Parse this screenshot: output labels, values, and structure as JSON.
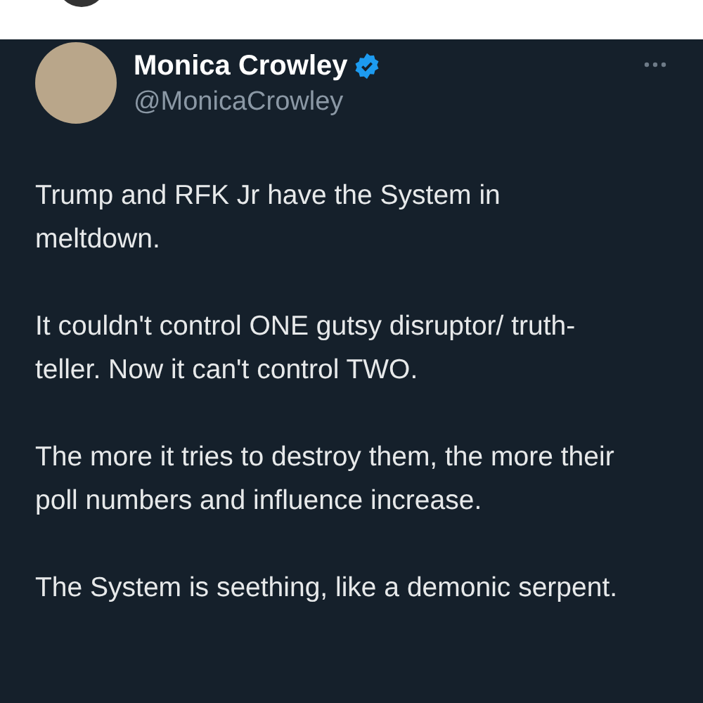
{
  "tweet": {
    "author": {
      "name": "Monica Crowley",
      "handle": "@MonicaCrowley",
      "verified": true
    },
    "paragraphs": [
      "Trump and RFK Jr have the System in meltdown.",
      "It couldn't control ONE gutsy disruptor/ truth-teller.  Now it can't control TWO.",
      "The more it tries to destroy them, the more their poll numbers and influence increase.",
      "The System is seething, like a demonic serpent."
    ]
  }
}
